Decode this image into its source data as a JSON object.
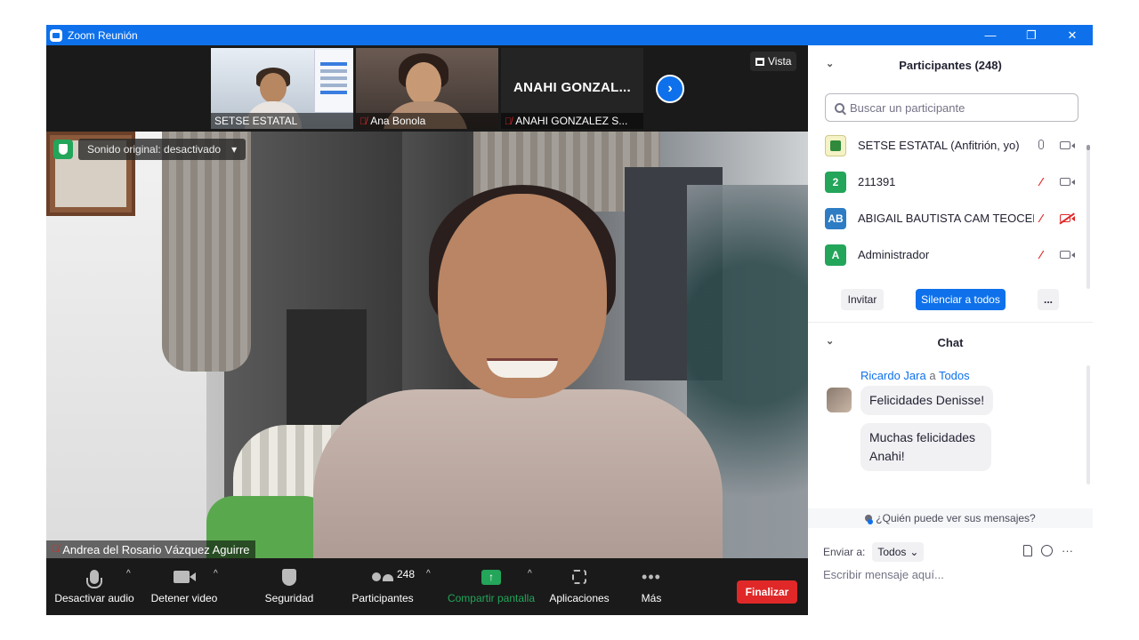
{
  "window": {
    "title": "Zoom Reunión",
    "minimize": "—",
    "restore": "❐",
    "close": "✕"
  },
  "strip": {
    "thumbs": [
      {
        "name": "SETSE ESTATAL",
        "muted": false
      },
      {
        "name": "Ana Bonola",
        "muted": true
      },
      {
        "name": "ANAHI GONZALEZ S...",
        "muted": true,
        "display_name": "ANAHI GONZAL..."
      }
    ],
    "next_arrow": "›",
    "view_label": "Vista"
  },
  "main_video": {
    "sound_label": "Sonido original: desactivado",
    "sound_caret": "▾",
    "speaker_name": "Andrea del Rosario Vázquez Aguirre"
  },
  "toolbar": {
    "audio": "Desactivar audio",
    "video": "Detener video",
    "security": "Seguridad",
    "participants": "Participantes",
    "participant_count": "248",
    "share": "Compartir pantalla",
    "share_arrow": "↑",
    "apps": "Aplicaciones",
    "more": "Más",
    "more_dots": "•••",
    "caret": "^",
    "end": "Finalizar"
  },
  "participants_panel": {
    "title": "Participantes (248)",
    "collapse": "⌄",
    "search_placeholder": "Buscar un participante",
    "rows": [
      {
        "initials": "",
        "name": "SETSE ESTATAL (Anfitrión, yo)",
        "color": "#f5f2c6",
        "mic": "on",
        "cam": "on"
      },
      {
        "initials": "2",
        "name": "211391",
        "color": "#23a55a",
        "mic": "off",
        "cam": "on"
      },
      {
        "initials": "AB",
        "name": "ABIGAIL BAUTISTA CAM TEOCELO",
        "color": "#2d7cc4",
        "mic": "off",
        "cam": "off"
      },
      {
        "initials": "A",
        "name": "Administrador",
        "color": "#23a55a",
        "mic": "off",
        "cam": "on"
      }
    ],
    "invite": "Invitar",
    "mute_all": "Silenciar a todos",
    "more": "..."
  },
  "chat": {
    "title": "Chat",
    "collapse": "⌄",
    "sender": "Ricardo Jara",
    "to_word": "a",
    "recipient": "Todos",
    "messages": [
      "Felicidades Denisse!",
      "Muchas felicidades Anahi!"
    ],
    "who_sees": "¿Quién puede ver sus mensajes?",
    "send_to_label": "Enviar a:",
    "send_to_value": "Todos",
    "send_caret": "⌄",
    "more_dots": "···",
    "compose_placeholder": "Escribir mensaje aquí..."
  },
  "colors": {
    "accent": "#0e71eb",
    "end": "#e02828",
    "share": "#23a55a",
    "muted": "#e02828"
  }
}
